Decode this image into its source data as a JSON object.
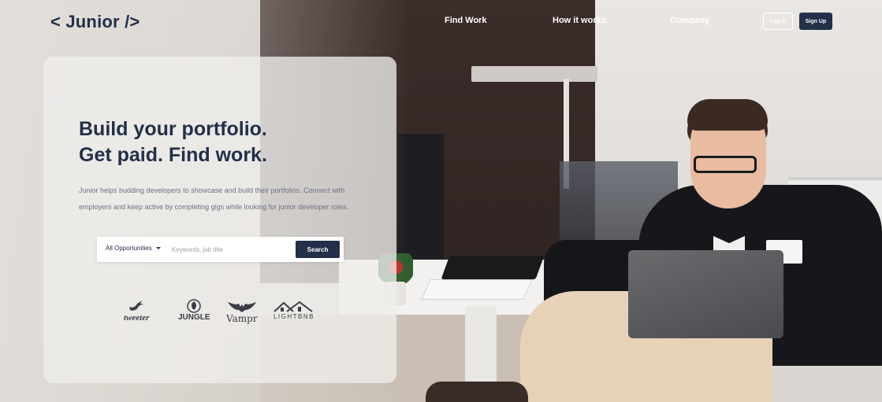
{
  "header": {
    "logo": "< Junior />",
    "nav": [
      {
        "label": "Find Work"
      },
      {
        "label": "How it works"
      },
      {
        "label": "Company"
      }
    ],
    "login_label": "Log In",
    "signup_label": "Sign Up"
  },
  "hero": {
    "headline_line1": "Build your portfolio.",
    "headline_line2": "Get paid. Find work.",
    "description": "Junior helps budding developers to showcase and build their portfolios. Connect with employers and keep active by completing gigs while looking for junior developer roles.",
    "search": {
      "category": "All Opportunities",
      "placeholder": "Keywords, job title",
      "button_label": "Search"
    }
  },
  "partners": [
    {
      "name": "tweeter",
      "icon": "bird-icon"
    },
    {
      "name": "JUNGLE",
      "icon": "leaf-icon"
    },
    {
      "name": "Vampr",
      "icon": "bat-icon"
    },
    {
      "name": "LIGHTBNB",
      "icon": "houses-icon"
    }
  ],
  "colors": {
    "brand_navy": "#223049",
    "text_muted": "#6d7280",
    "white": "#ffffff"
  }
}
